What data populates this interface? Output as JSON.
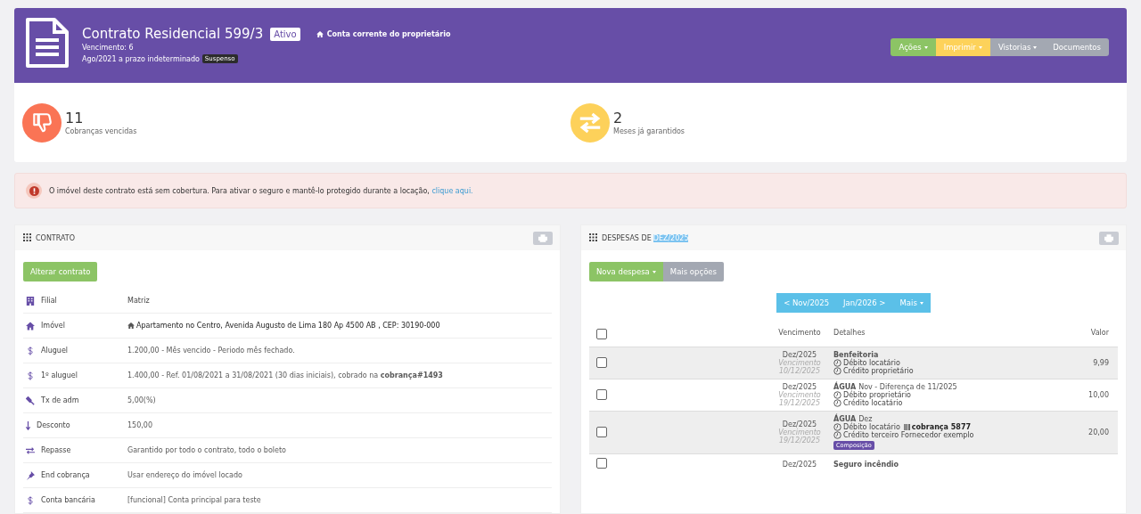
{
  "header": {
    "title": "Contrato Residencial 599/3",
    "status_badge": "Ativo",
    "owner_link": "Conta corrente do proprietário",
    "due": "Vencimento: 6",
    "period": "Ago/2021 a prazo indeterminado",
    "period_badge": "Suspenso",
    "actions": [
      {
        "label": "Ações",
        "kind": "success",
        "dropdown": true
      },
      {
        "label": "Imprimir",
        "kind": "warning",
        "dropdown": true
      },
      {
        "label": "Vistorias",
        "kind": "default",
        "dropdown": true
      },
      {
        "label": "Documentos",
        "kind": "default",
        "dropdown": false
      }
    ]
  },
  "stats": [
    {
      "value": "11",
      "label": "Cobranças vencidas",
      "kind": "overdue"
    },
    {
      "value": "2",
      "label": "Meses já garantidos",
      "kind": "guaranteed"
    }
  ],
  "alert": {
    "text": "O imóvel deste contrato está sem cobertura. Para ativar o seguro e mantê-lo protegido durante a locação,",
    "link": "clique aqui."
  },
  "contract": {
    "title": "CONTRATO",
    "edit_button": "Alterar contrato",
    "fields": [
      {
        "label": "Filial",
        "value": "Matriz",
        "kind": "plain"
      },
      {
        "label": "Imóvel",
        "value": "Apartamento no Centro, Avenida Augusto de Lima 180 Ap 4500 AB , CEP: 30190-000",
        "kind": "property"
      },
      {
        "label": "Aluguel",
        "value": "1.200,00 - Mês vencido - Periodo mês fechado.",
        "kind": "muted"
      },
      {
        "label": "1º aluguel",
        "value": "1.400,00 - Ref. 01/08/2021 a 31/08/2021 (30 dias iniciais), cobrado na **cobrança#1493**",
        "kind": "muted"
      },
      {
        "label": "Tx de adm",
        "value": "5,00(%)",
        "kind": "muted"
      },
      {
        "label": "Desconto",
        "value": "150,00",
        "kind": "muted"
      },
      {
        "label": "Repasse",
        "value": "Garantido por todo o contrato, todo o boleto",
        "kind": "muted"
      },
      {
        "label": "End cobrança",
        "value": "Usar endereço do imóvel locado",
        "kind": "muted"
      },
      {
        "label": "Conta bancária",
        "value": "[funcional] Conta principal para teste",
        "kind": "muted"
      }
    ]
  },
  "expenses": {
    "title": "DESPESAS DE",
    "title_month": "DEZ/2025",
    "new_button": "Nova despesa",
    "more_button": "Mais opções",
    "pager": [
      {
        "label": "< Nov/2025",
        "dropdown": false
      },
      {
        "label": "Jan/2026 >",
        "dropdown": false
      },
      {
        "label": "Mais",
        "dropdown": true
      }
    ],
    "select_all_checked": false,
    "columns": [
      "Vencimento",
      "Detalhes",
      "Valor"
    ],
    "rows": [
      {
        "checked": false,
        "month": "Dez/2025",
        "due_label": "Vencimento",
        "due_date": "10/12/2025",
        "title": "Benfeitoria",
        "lines": [
          {
            "text": "Débito locatário"
          },
          {
            "text": "Crédito proprietário"
          }
        ],
        "value": "9,99"
      },
      {
        "checked": false,
        "month": "Dez/2025",
        "due_label": "Vencimento",
        "due_date": "19/12/2025",
        "title": "ÁGUA",
        "title_suffix": "Nov - Diferença de 11/2025",
        "lines": [
          {
            "text": "Débito proprietário"
          },
          {
            "text": "Crédito locatário"
          }
        ],
        "value": "10,00"
      },
      {
        "checked": false,
        "month": "Dez/2025",
        "due_label": "Vencimento",
        "due_date": "19/12/2025",
        "title": "ÁGUA",
        "title_suffix": "Dez",
        "lines": [
          {
            "text": "Débito locatário",
            "link": "cobrança 5877"
          },
          {
            "text": "Crédito terceiro Fornecedor exemplo"
          }
        ],
        "tag": "Composição",
        "value": "20,00"
      },
      {
        "checked": false,
        "month": "Dez/2025",
        "title": "Seguro incêndio",
        "lines": []
      }
    ]
  }
}
